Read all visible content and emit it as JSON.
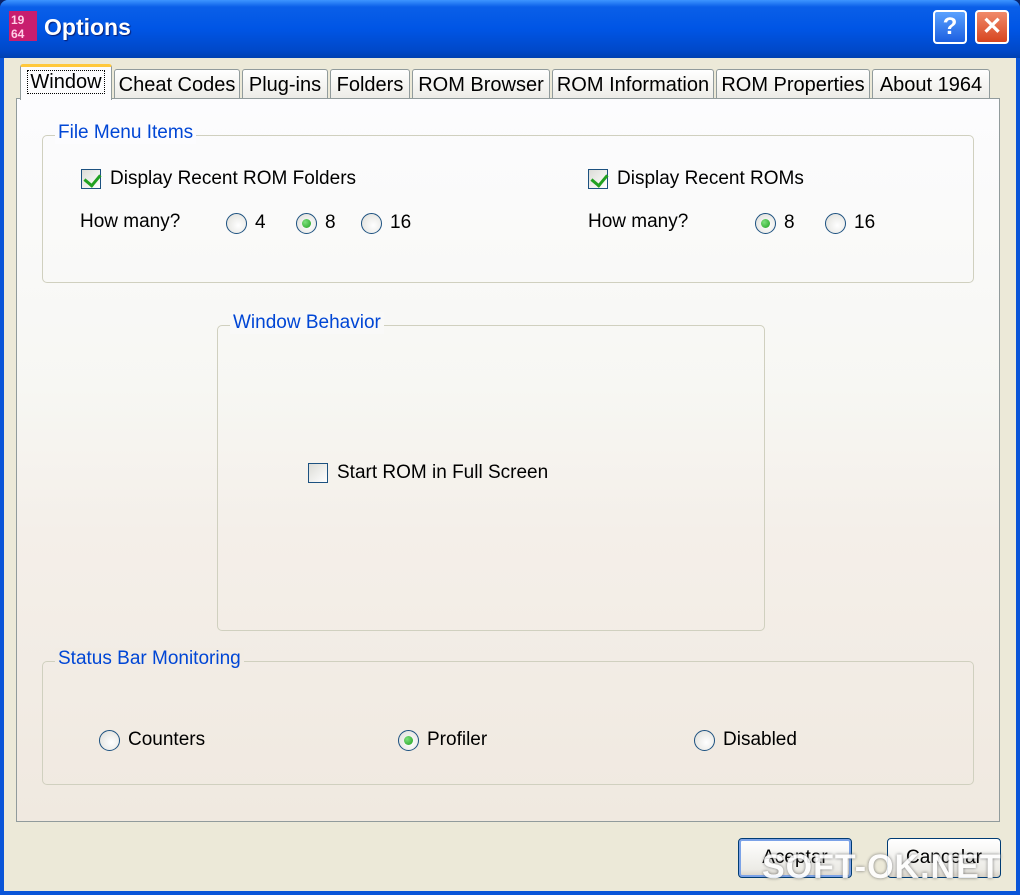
{
  "window": {
    "title": "Options",
    "app_icon": "n64-1964-icon",
    "help_glyph": "?",
    "close_glyph": "✕"
  },
  "tabs": [
    {
      "label": "Window",
      "active": true
    },
    {
      "label": "Cheat Codes"
    },
    {
      "label": "Plug-ins"
    },
    {
      "label": "Folders"
    },
    {
      "label": "ROM Browser"
    },
    {
      "label": "ROM Information"
    },
    {
      "label": "ROM Properties"
    },
    {
      "label": "About 1964"
    }
  ],
  "file_menu": {
    "legend": "File Menu Items",
    "recent_folders": {
      "label": "Display Recent ROM Folders",
      "checked": true
    },
    "recent_roms": {
      "label": "Display Recent ROMs",
      "checked": true
    },
    "how_many_label": "How many?",
    "folder_options": [
      "4",
      "8",
      "16"
    ],
    "folder_selected": "8",
    "rom_options": [
      "8",
      "16"
    ],
    "rom_selected": "8"
  },
  "window_behavior": {
    "legend": "Window Behavior",
    "fullscreen": {
      "label": "Start ROM in Full Screen",
      "checked": false
    }
  },
  "status_bar": {
    "legend": "Status Bar Monitoring",
    "options": [
      "Counters",
      "Profiler",
      "Disabled"
    ],
    "selected": "Profiler"
  },
  "buttons": {
    "ok": "Aceptar",
    "cancel": "Cancelar"
  },
  "watermark": "SOFT-OK.NET",
  "colors": {
    "title_blue": "#0055e5",
    "legend_blue": "#0046d5",
    "dialog_bg": "#ece9d8",
    "check_green": "#21a121"
  }
}
